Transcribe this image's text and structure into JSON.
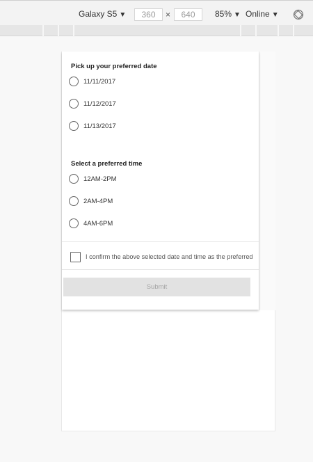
{
  "devtools": {
    "device": "Galaxy S5",
    "width": "360",
    "height": "640",
    "separator": "×",
    "zoom": "85%",
    "network": "Online",
    "dropdown_arrow": "▼",
    "rotate_icon": "rotate-icon"
  },
  "form": {
    "date_title": "Pick up your preferred date",
    "dates": [
      "11/11/2017",
      "11/12/2017",
      "11/13/2017"
    ],
    "time_title": "Select a preferred time",
    "times": [
      "12AM-2PM",
      "2AM-4PM",
      "4AM-6PM"
    ],
    "confirm_label": "I confirm the above selected date and time as the preferred",
    "submit_label": "Submit"
  }
}
